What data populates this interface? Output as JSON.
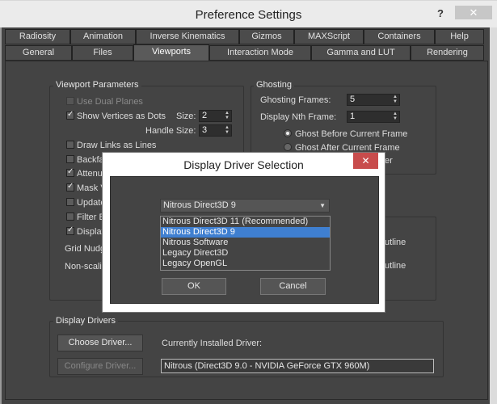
{
  "window": {
    "title": "Preference Settings",
    "help_glyph": "?",
    "close_glyph": "✕"
  },
  "tabs_row1": [
    "Radiosity",
    "Animation",
    "Inverse Kinematics",
    "Gizmos",
    "MAXScript",
    "Containers",
    "Help"
  ],
  "tabs_row2": [
    "General",
    "Files",
    "Viewports",
    "Interaction Mode",
    "Gamma and LUT",
    "Rendering"
  ],
  "active_tab": "Viewports",
  "viewport_params": {
    "label": "Viewport Parameters",
    "use_dual_planes": "Use Dual Planes",
    "show_vertices": "Show Vertices as Dots",
    "size_label": "Size:",
    "size_value": "2",
    "handle_size_label": "Handle Size:",
    "handle_size_value": "3",
    "items": [
      "Draw Links as Lines",
      "Backfa",
      "Attenu",
      "Mask V",
      "Update",
      "Filter E",
      "Display"
    ],
    "grid_nudge": "Grid Nudg",
    "non_scaling": "Non-scalin"
  },
  "ghosting": {
    "label": "Ghosting",
    "frames_label": "Ghosting Frames:",
    "frames_value": "5",
    "nth_label": "Display Nth Frame:",
    "nth_value": "1",
    "before": "Ghost Before Current Frame",
    "after": "Ghost After Current Frame",
    "fragment": "er",
    "outline1": "utline",
    "outline2": "utline"
  },
  "display_drivers": {
    "label": "Display Drivers",
    "choose": "Choose Driver...",
    "configure": "Configure Driver...",
    "installed_label": "Currently Installed Driver:",
    "installed_value": "Nitrous (Direct3D 9.0 - NVIDIA GeForce GTX 960M)"
  },
  "modal": {
    "title": "Display Driver Selection",
    "close_glyph": "✕",
    "selected": "Nitrous Direct3D 9",
    "options": [
      "Nitrous Direct3D 11 (Recommended)",
      "Nitrous Direct3D 9",
      "Nitrous Software",
      "Legacy Direct3D",
      "Legacy OpenGL"
    ],
    "ok": "OK",
    "cancel": "Cancel"
  }
}
